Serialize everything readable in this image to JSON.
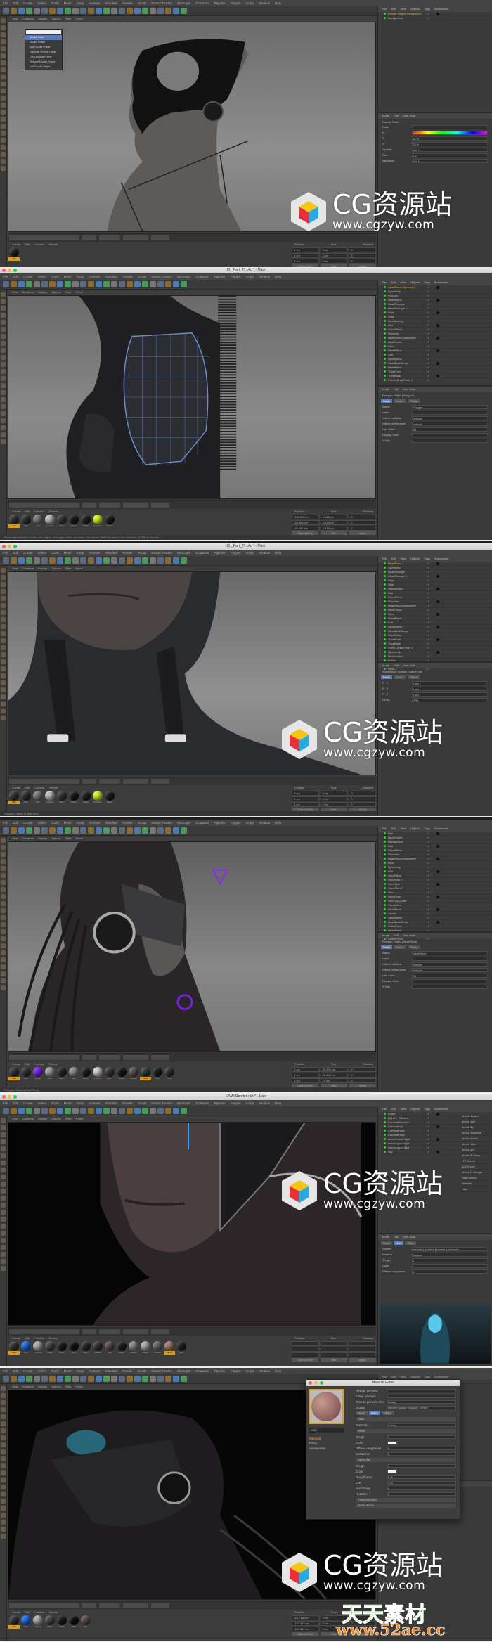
{
  "menu": [
    "File",
    "Edit",
    "Create",
    "Select",
    "Tools",
    "Mesh",
    "Snap",
    "Animate",
    "Simulate",
    "Render",
    "Sculpt",
    "Motion Tracker",
    "MoGraph",
    "Character",
    "Pipeline",
    "Plugins",
    "Script",
    "Window",
    "Help"
  ],
  "viewport_menu": [
    "View",
    "Cameras",
    "Display",
    "Options",
    "Filter",
    "Panel"
  ],
  "om_menu": [
    "File",
    "Edit",
    "View",
    "Objects",
    "Tags",
    "Bookmarks"
  ],
  "am_menu": [
    "Mode",
    "Edit",
    "User Data"
  ],
  "mat_menu": [
    "Create",
    "Edit",
    "Function",
    "Texture"
  ],
  "coord_headers": [
    "Position",
    "Size",
    "Rotation"
  ],
  "coord_buttons": [
    "Object (Rel)",
    "Size",
    "Apply"
  ],
  "panels": [
    {
      "title": "",
      "objects": [
        "Doodle Object Perspective",
        "Background"
      ],
      "attr_title": "Doodle Paint",
      "attr_tabs": [],
      "attr_rows": [
        [
          "Color",
          ""
        ],
        [
          "H",
          "258 °"
        ],
        [
          "S",
          "30 %"
        ],
        [
          "V",
          "75 %"
        ],
        [
          "Opacity",
          "100 %"
        ],
        [
          "Size",
          "7.8"
        ],
        [
          "Hardness",
          "100 %"
        ]
      ],
      "materials": [
        {
          "label": "Mat",
          "color": "#222"
        }
      ],
      "coords": [
        [
          "0 cm",
          "0 cm",
          "0 °"
        ],
        [
          "0 cm",
          "0 cm",
          "0 °"
        ],
        [
          "0 cm",
          "0 cm",
          "0 °"
        ]
      ],
      "status": "",
      "dropdown": [
        "Doodle Paint",
        "Doodle Eraser",
        "Add Doodle Frame",
        "Duplicate Doodle Frame",
        "Clear Doodle Frame",
        "Remove Doodle Frame",
        "Add Doodle Object"
      ]
    },
    {
      "title": "Ch_Part_2?.c4d * - Main",
      "objects": [
        "HeadPiece Symmetry",
        "Symmetry",
        "Polygon",
        "HeadSkirts",
        "HeadTriangle",
        "HeadTriangle.1",
        "Strip",
        "Strip",
        "HairBacking",
        "Hair",
        "ChestPiece",
        "Shoulder",
        "HeadPieceGlassInsert",
        "NeckCover",
        "Hips",
        "WaistPiece",
        "Suit",
        "Spinepiece",
        "HeadBackStrap",
        "WaistPiece",
        "TubeFront",
        "TubeBack",
        "Chest_Ares Piece 1"
      ],
      "attr_title": "Polygon Object [Polygon]",
      "attr_tabs": [
        "Basic",
        "Coord.",
        "Phong"
      ],
      "attr_rows": [
        [
          "Name",
          "Polygon"
        ],
        [
          "Layer",
          ""
        ],
        [
          "Visible in Editor",
          "Default"
        ],
        [
          "Visible in Renderer",
          "Default"
        ],
        [
          "Use Color",
          "Off"
        ],
        [
          "Display Color",
          ""
        ],
        [
          "X-Ray",
          ""
        ]
      ],
      "materials": [
        {
          "label": "Mat",
          "color": "#333"
        },
        {
          "label": "Skin",
          "color": "#2e2e2e"
        },
        {
          "label": "Hair",
          "color": "#777"
        },
        {
          "label": "Chrome",
          "color": "#bbb"
        },
        {
          "label": "Mat.1",
          "color": "#3a3332"
        },
        {
          "label": "Black",
          "color": "#1a1a1a"
        },
        {
          "label": "Metal",
          "color": "#222"
        },
        {
          "label": "Emissive",
          "color": "#d8f020"
        },
        {
          "label": "Plastic",
          "color": "#1c1c1c"
        }
      ],
      "coords": [
        [
          "-130.698 cm",
          "6.958 cm",
          "0 °"
        ],
        [
          "-40.459 cm",
          "3.619 cm",
          "0 °"
        ],
        [
          "-93.151 cm",
          "3.915 cm",
          "0 °"
        ]
      ],
      "status": "Rectangle Selection: Click and drag to rectangle-select elements. Hold down SHIFT to add to the selection, CTRL to remove."
    },
    {
      "title": "Ch_Part_2?.c4d * - Main",
      "objects": [
        "HeadPiece.1",
        "Symmetry",
        "HeadTriangle",
        "HeadTriangle.1",
        "Strip",
        "Strip",
        "HairBacking",
        "Hair",
        "ChestPiece",
        "Shoulder",
        "HeadPieceGlassInsert",
        "NeckCover",
        "Hips",
        "WaistPiece",
        "Suit",
        "Spinepiece",
        "HeadBackStrap",
        "WaistPiece",
        "TubeFront",
        "TubeBack",
        "Chest_Ares Piece 1",
        "Symmetry",
        "NeckHolder",
        "Bridge",
        "Neck",
        "Neck.1"
      ],
      "attr_title": "Subdivision Surface [TubeFront]",
      "attr_tabs": [
        "Basic",
        "Coord.",
        "Object"
      ],
      "attr_rows": [
        [
          "P . X",
          "0 cm"
        ],
        [
          "P . Y",
          "0 cm"
        ],
        [
          "P . Z",
          "0 cm"
        ],
        [
          "Order",
          "HPB"
        ]
      ],
      "materials": [
        {
          "label": "Mat",
          "color": "#333"
        },
        {
          "label": "Skin",
          "color": "#2e2e2e"
        },
        {
          "label": "Hair",
          "color": "#777"
        },
        {
          "label": "Chrome",
          "color": "#bbb"
        },
        {
          "label": "Mat.1",
          "color": "#3a3332"
        },
        {
          "label": "Black",
          "color": "#1a1a1a"
        },
        {
          "label": "Metal",
          "color": "#222"
        },
        {
          "label": "Emissive",
          "color": "#d8f020"
        },
        {
          "label": "Plastic",
          "color": "#1c1c1c"
        }
      ],
      "coords": [
        [
          "0 cm",
          "0 cm",
          "0 °"
        ],
        [
          "0 cm",
          "0 cm",
          "0 °"
        ],
        [
          "0 cm",
          "0 cm",
          "0 °"
        ]
      ],
      "status": "Polygon Object [TubeFront]"
    },
    {
      "title": "",
      "objects": [
        "Hair",
        "NeckHolder",
        "HairBacking",
        "Hair",
        "ChestPiece",
        "Shoulder",
        "HeadPieceGlassInsert",
        "Hips",
        "Symmetry",
        "Null",
        "VisorPiece",
        "VisorSide.1",
        "VisorSide",
        "VisorSide.2",
        "Visor",
        "VisorFront",
        "VisorTopCover",
        "VisorInsert",
        "NeckPiece",
        "Jacket",
        "Spinepiece",
        "HeadBackStrap",
        "WaistPiece",
        "HeadPiece",
        "Symmetry",
        "LowerPiece"
      ],
      "attr_title": "Polygon Object [VisorPiece]",
      "attr_tabs": [
        "Basic",
        "Coord.",
        "Phong"
      ],
      "attr_rows": [
        [
          "Name",
          "VisorPiece"
        ],
        [
          "Layer",
          ""
        ],
        [
          "Visible in Editor",
          "Default"
        ],
        [
          "Visible in Renderer",
          "Default"
        ],
        [
          "Use Color",
          "Off"
        ],
        [
          "Display Color",
          ""
        ],
        [
          "X-Ray",
          ""
        ]
      ],
      "materials": [
        {
          "label": "Mat",
          "color": "#333"
        },
        {
          "label": "Skin",
          "color": "#2e2e2e"
        },
        {
          "label": "Purple",
          "color": "#7a20f0"
        },
        {
          "label": "Grey",
          "color": "#999"
        },
        {
          "label": "Mat.1",
          "color": "#252525"
        },
        {
          "label": "Hair",
          "color": "#888"
        },
        {
          "label": "Metal",
          "color": "#1e1e1e"
        },
        {
          "label": "Chrome",
          "color": "#ccc"
        },
        {
          "label": "Mat.2",
          "color": "#3a3332"
        },
        {
          "label": "Black",
          "color": "#161616"
        },
        {
          "label": "Rubber",
          "color": "#5a5048"
        },
        {
          "label": "Visor",
          "color": "#2a3a40"
        },
        {
          "label": "Dark",
          "color": "#1a1a1a"
        },
        {
          "label": "Lens",
          "color": "#303030"
        }
      ],
      "coords": [
        [
          "0 cm",
          "55.539 cm",
          "0 °"
        ],
        [
          "0 cm",
          "50.654 cm",
          "0 °"
        ],
        [
          "0 cm",
          "76 cm",
          "0 °"
        ]
      ],
      "status": "Polygon Object [VisorPiece]"
    },
    {
      "title": "FINALRender.c4d * - Main",
      "objects": [
        "Ethan",
        "Lights + Camera",
        "CameraDirection",
        "CameraKey",
        "CameraFront",
        "CameraFront",
        "Arnold mesh light",
        "Arnold quad light",
        "Arnold quad light",
        "Sky"
      ],
      "attr_title": "",
      "attr_tabs": [
        "Basic",
        "Main",
        "Ships"
      ],
      "attr_rows": [
        [
          "Shader",
          "standard_surface (standard_surface)"
        ],
        [
          "Material",
          "Custom"
        ],
        [
          "Weight",
          "1"
        ],
        [
          "Color",
          ""
        ],
        [
          "Diffuse roughness",
          "0"
        ]
      ],
      "materials": [
        {
          "label": "Mat",
          "color": "#333"
        },
        {
          "label": "Visor",
          "color": "#1a6ae0"
        },
        {
          "label": "Chrome",
          "color": "#aaa"
        },
        {
          "label": "Metal",
          "color": "#444"
        },
        {
          "label": "Black",
          "color": "#1a1a1a"
        },
        {
          "label": "Dark",
          "color": "#111"
        },
        {
          "label": "Mat.1",
          "color": "#2a2a2a"
        },
        {
          "label": "Leather",
          "color": "#3a3030"
        },
        {
          "label": "Skin",
          "color": "#5a4a48"
        },
        {
          "label": "Plastic",
          "color": "#1e1e1e"
        },
        {
          "label": "Metal.1",
          "color": "#888"
        },
        {
          "label": "Glass",
          "color": "#aaa"
        },
        {
          "label": "Rubber",
          "color": "#666"
        },
        {
          "label": "Skin.1",
          "color": "#a07a6a"
        },
        {
          "label": "Lens",
          "color": "#222"
        }
      ],
      "coords": [
        [
          "",
          "",
          ""
        ],
        [
          "",
          "",
          ""
        ],
        [
          "",
          "",
          ""
        ]
      ],
      "status": "",
      "side_list": [
        "Arnold Camera",
        "Arnold Light",
        "Arnold Sky",
        "Arnold Procedural",
        "Arnold Volume",
        "Arnold Driver",
        "Arnold AOV",
        "Arnold TP Group",
        "LPE Volume",
        "AOV Export",
        "Arnold Tx Manager",
        "Flush caches",
        "Materials",
        "Help"
      ]
    },
    {
      "title": "",
      "objects": [
        "Ethan",
        "Lights + Camera"
      ],
      "attr_title": "",
      "attr_tabs": [],
      "attr_rows": [],
      "materials": [
        {
          "label": "Mat",
          "color": "#333"
        },
        {
          "label": "Visor",
          "color": "#1a6ae0"
        },
        {
          "label": "Chrome",
          "color": "#aaa"
        },
        {
          "label": "Metal",
          "color": "#444"
        },
        {
          "label": "Black",
          "color": "#1a1a1a"
        },
        {
          "label": "Dark",
          "color": "#111"
        },
        {
          "label": "Skin",
          "color": "#5a4a48"
        }
      ],
      "coords": [
        [
          "112.768 cm",
          "0 cm",
          "0 °"
        ],
        [
          "-133.046 cm",
          "0 cm",
          "0 °"
        ],
        [
          "-163.616 cm",
          "0 cm",
          "0 °"
        ]
      ],
      "status": ""
    }
  ],
  "material_editor": {
    "title": "Material Editor",
    "name": "Skin",
    "channels": [
      "Material",
      "Editor",
      "Assignment"
    ],
    "top_rows": [
      [
        "Render preview",
        ""
      ],
      [
        "Editor preview",
        ""
      ],
      [
        "Texture preview size",
        "Default"
      ],
      [
        "Shader",
        "standard_surface (standard_surface)"
      ]
    ],
    "tabs": [
      "Basic",
      "Main",
      "Ships"
    ],
    "main_label": "Main",
    "material_row": [
      "Material",
      "Custom"
    ],
    "base_label": "Base",
    "base_rows": [
      [
        "Weight",
        "1"
      ],
      [
        "Color",
        ""
      ],
      [
        "Diffuse roughness",
        "0"
      ],
      [
        "Metalness",
        "0"
      ]
    ],
    "specular_label": "Specular",
    "specular_rows": [
      [
        "Weight",
        "1"
      ],
      [
        "Color",
        ""
      ],
      [
        "Roughness",
        "0.35"
      ],
      [
        "IOR",
        "1.44"
      ],
      [
        "Anisotropy",
        "0"
      ],
      [
        "Rotation",
        "0"
      ]
    ],
    "collapsed": [
      "Transmission",
      "Subsurface"
    ]
  },
  "watermark": {
    "brand": "CG资源站",
    "url": "www.cgzyw.com",
    "brand2": "天天素材",
    "url2": "www.52ae.cc",
    "colors": {
      "top": "#f5c518",
      "left": "#e8303a",
      "right": "#2aa8e0"
    }
  }
}
